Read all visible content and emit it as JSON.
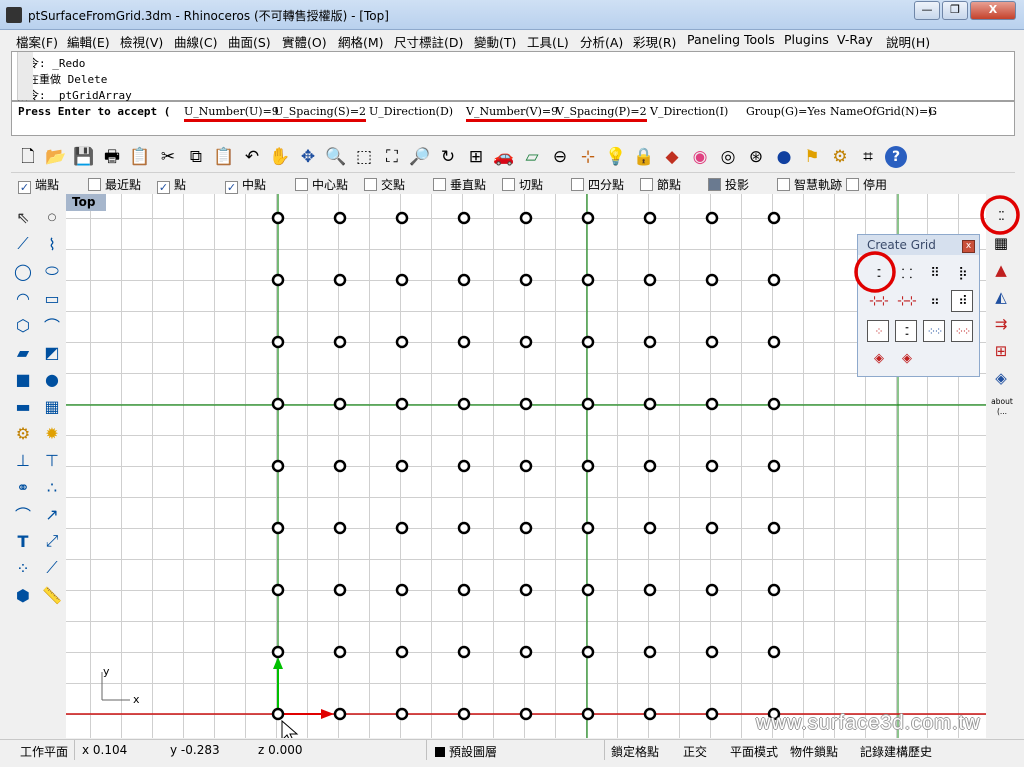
{
  "window": {
    "title": "ptSurfaceFromGrid.3dm - Rhinoceros (不可轉售授權版) - [Top]",
    "min_label": "—",
    "max_label": "❐",
    "close_label": "X"
  },
  "menu": [
    "檔案(F)",
    "編輯(E)",
    "檢視(V)",
    "曲線(C)",
    "曲面(S)",
    "實體(O)",
    "網格(M)",
    "尺寸標註(D)",
    "變動(T)",
    "工具(L)",
    "分析(A)",
    "彩現(R)",
    "Paneling Tools",
    "Plugins",
    "V-Ray",
    "說明(H)"
  ],
  "command_history": [
    "指令: _Redo",
    "正在重做 Delete",
    "指令: _ptGridArray"
  ],
  "command_prompt": {
    "lead": "Press Enter to accept (",
    "opt1": "U_Number(U)=9",
    "opt2": "U_Spacing(S)=2",
    "opt3": "U_Direction(D)",
    "opt4": "V_Number(V)=9",
    "opt5": "V_Spacing(P)=2",
    "opt6": "V_Direction(I)",
    "opt7": "Group(G)=Yes",
    "opt8": "NameOfGrid(N)=G",
    "tail": "):"
  },
  "osnaps": [
    {
      "label": "端點",
      "checked": true
    },
    {
      "label": "最近點",
      "checked": false
    },
    {
      "label": "點",
      "checked": true
    },
    {
      "label": "中點",
      "checked": true
    },
    {
      "label": "中心點",
      "checked": false
    },
    {
      "label": "交點",
      "checked": false
    },
    {
      "label": "垂直點",
      "checked": false
    },
    {
      "label": "切點",
      "checked": false
    },
    {
      "label": "四分點",
      "checked": false
    },
    {
      "label": "節點",
      "checked": false
    },
    {
      "label": "投影",
      "checked": false
    },
    {
      "label": "智慧軌跡",
      "checked": false
    },
    {
      "label": "停用",
      "checked": false
    }
  ],
  "viewport": {
    "label": "Top",
    "axis_y": "y",
    "axis_x": "x",
    "grid_points": {
      "u_number": 9,
      "v_number": 9
    }
  },
  "create_grid_panel": {
    "title": "Create Grid",
    "close": "x"
  },
  "about_label": "about",
  "about_sub": "(...",
  "watermark": "www.surface3d.com.tw",
  "status": {
    "cplane": "工作平面",
    "x": "x 0.104",
    "y": "y -0.283",
    "z": "z 0.000",
    "layer": "預設圖層",
    "snap": "鎖定格點",
    "ortho": "正交",
    "planar": "平面模式",
    "osnap": "物件鎖點",
    "history": "記錄建構歷史"
  },
  "colors": {
    "highlight_circle": "#e00000",
    "x_axis": "#e00000",
    "y_axis": "#00c000",
    "grid_axis": "#1a8a1a"
  }
}
